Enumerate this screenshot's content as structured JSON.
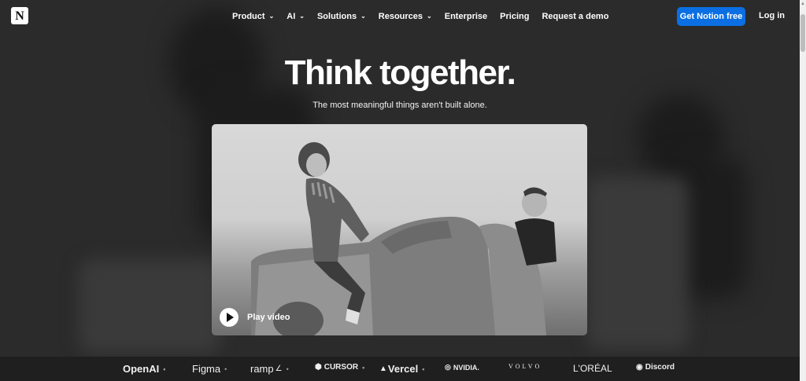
{
  "nav": {
    "logo_glyph": "N",
    "items": [
      {
        "label": "Product",
        "has_menu": true
      },
      {
        "label": "AI",
        "has_menu": true
      },
      {
        "label": "Solutions",
        "has_menu": true
      },
      {
        "label": "Resources",
        "has_menu": true
      },
      {
        "label": "Enterprise",
        "has_menu": false
      },
      {
        "label": "Pricing",
        "has_menu": false
      },
      {
        "label": "Request a demo",
        "has_menu": false
      }
    ],
    "cta_label": "Get Notion free",
    "login_label": "Log in"
  },
  "hero": {
    "title": "Think together.",
    "subtitle": "The most meaningful things aren't built alone."
  },
  "video": {
    "play_label": "Play video"
  },
  "logos": [
    {
      "name": "OpenAI",
      "dot": "•"
    },
    {
      "name": "Figma",
      "dot": "•"
    },
    {
      "name": "ramp",
      "dot": "•"
    },
    {
      "name": "CURSOR",
      "dot": "•"
    },
    {
      "name": "Vercel",
      "dot": "•"
    },
    {
      "name": "NVIDIA.",
      "dot": ""
    },
    {
      "name": "VOLVO",
      "dot": ""
    },
    {
      "name": "L'ORÉAL",
      "dot": ""
    },
    {
      "name": "Discord",
      "dot": ""
    }
  ],
  "colors": {
    "cta_blue": "#0b6fe3",
    "background": "#2b2b2b"
  }
}
